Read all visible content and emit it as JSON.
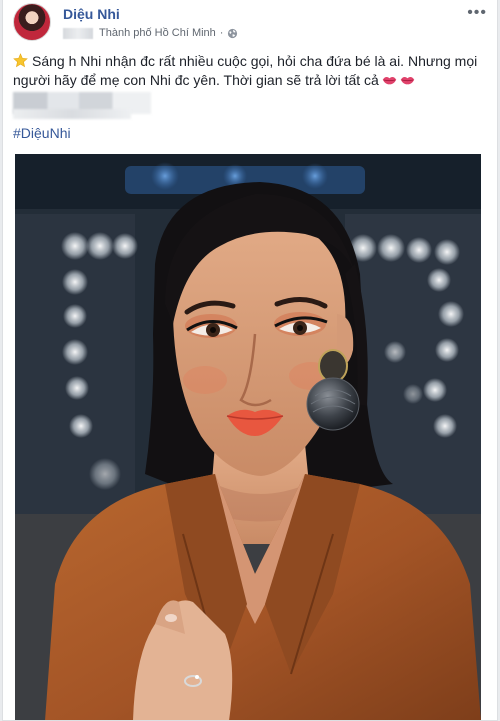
{
  "post": {
    "author": "Diệu Nhi",
    "location": "Thành phố Hồ Chí Minh",
    "separator": "·",
    "more_label": "•••",
    "text_line1": "Sáng h Nhi nhận đc rất nhiều cuộc gọi, hỏi cha đứa bé là ai. Nhưng mọi người hãy để mẹ con Nhi đc yên. Thời gian sẽ trả lời tất cả",
    "hashtag": "#DiệuNhi"
  },
  "icons": {
    "star": "star-emoji-icon",
    "lips": "kiss-mark-icon",
    "globe": "globe-icon",
    "more": "more-options-icon"
  },
  "colors": {
    "link": "#365899",
    "text": "#1d2129",
    "meta": "#606770",
    "blazer": "#a65a2a"
  }
}
